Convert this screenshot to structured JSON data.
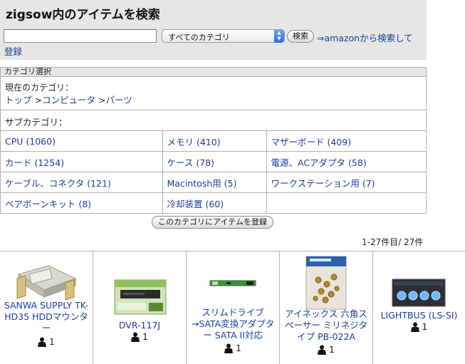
{
  "header": {
    "title": "zigsow内のアイテムを検索"
  },
  "search": {
    "query": "",
    "category_selected": "すべてのカテゴリ",
    "button_label": "検索",
    "amazon_link": "⇒amazonから検索して",
    "register_link": "登録"
  },
  "category": {
    "section_title": "カテゴリ選択",
    "current_label": "現在のカテゴリ：",
    "breadcrumb": [
      {
        "label": "トップ",
        "sep": " >"
      },
      {
        "label": "コンピュータ",
        "sep": " >"
      },
      {
        "label": "パーツ",
        "sep": ""
      }
    ],
    "sub_label": "サブカテゴリ：",
    "subcategories": [
      [
        "CPU (1060)",
        "メモリ (410)",
        "マザーボード (409)"
      ],
      [
        "カード (1254)",
        "ケース (78)",
        "電源、ACアダプタ (58)"
      ],
      [
        "ケーブル、コネクタ (121)",
        "Macintosh用 (5)",
        "ワークステーション用 (7)"
      ],
      [
        "ベアボーンキット (8)",
        "冷却装置 (60)",
        ""
      ]
    ],
    "add_item_button": "このカテゴリにアイテムを登録"
  },
  "results": {
    "count_text": "1-27件目/ 27件"
  },
  "products": [
    {
      "name": "SANWA SUPPLY TK-HD35 HDDマウンター",
      "owners": "1",
      "icon": "hdd-mounter-image"
    },
    {
      "name": "DVR-117J",
      "owners": "1",
      "icon": "dvd-drive-box-image"
    },
    {
      "name": "スリムドライブ→SATA変換アダプター SATA II対応",
      "owners": "1",
      "icon": "adapter-board-image"
    },
    {
      "name": "アイネックス 六角スペーサー ミリネジタイプ PB-022A",
      "owners": "1",
      "icon": "screw-pack-image"
    },
    {
      "name": "LIGHTBUS (LS-SI)",
      "owners": "1",
      "icon": "bay-panel-image"
    }
  ],
  "colors": {
    "link": "#1a3d9c",
    "panel_bg": "#e6e6e6",
    "border": "#b0b0b0"
  }
}
